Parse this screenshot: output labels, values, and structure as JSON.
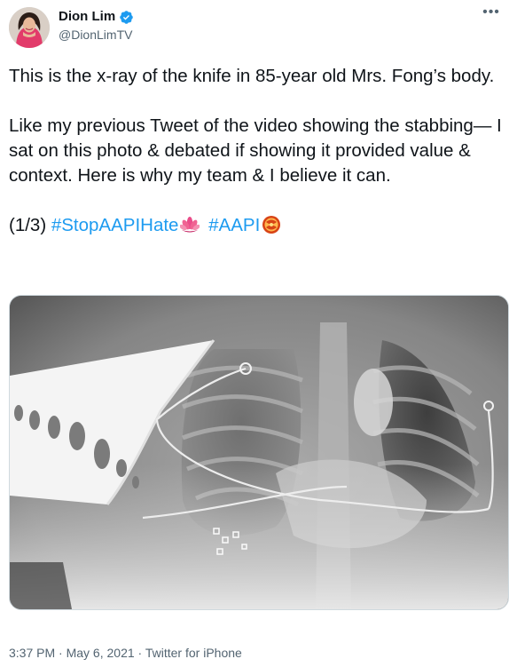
{
  "author": {
    "display_name": "Dion Lim",
    "handle": "@DionLimTV",
    "verified": true,
    "avatar_icon": "profile-photo"
  },
  "menu_icon": "more-options-icon",
  "tweet": {
    "paragraph1": "This is the x-ray of the knife in 85-year old Mrs. Fong’s body.",
    "paragraph2": "Like my previous Tweet of the video showing the stabbing— I sat on this photo & debated if showing it provided value & context. Here is why my team & I believe it can.",
    "thread_marker": "(1/3)",
    "hashtag1": "#StopAAPIHate",
    "hashtag1_emoji": "lotus-emoji",
    "hashtag2": "#AAPI",
    "hashtag2_emoji": "knot-emoji"
  },
  "meta": {
    "time": "3:37 PM",
    "date": "May 6, 2021",
    "source": "Twitter for iPhone",
    "separator": "·"
  },
  "colors": {
    "link": "#1d9bf0",
    "text": "#0f1419",
    "secondary": "#536471",
    "verified_badge": "#1d9bf0"
  }
}
